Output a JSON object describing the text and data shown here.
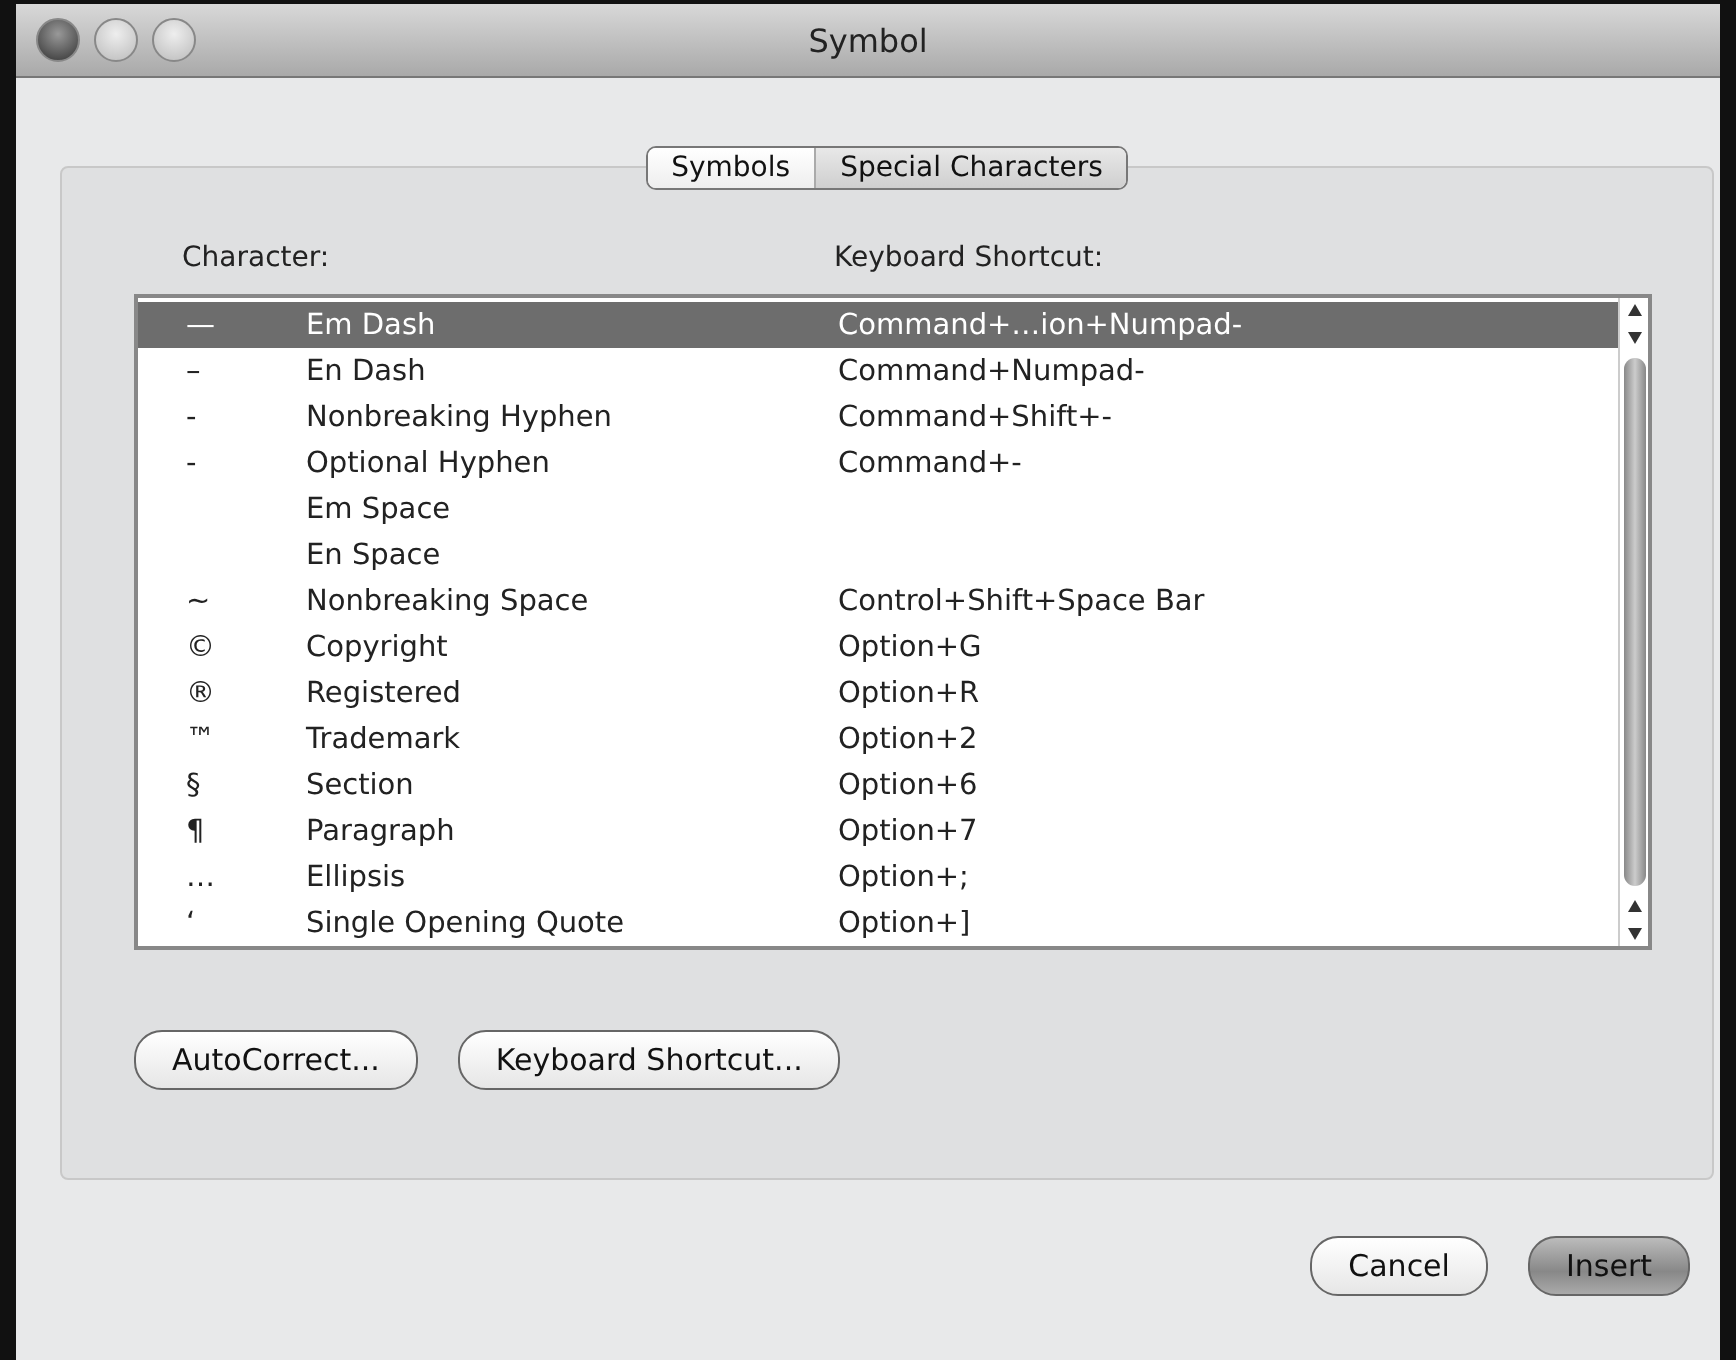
{
  "window": {
    "title": "Symbol"
  },
  "tabs": [
    {
      "label": "Symbols",
      "selected": false
    },
    {
      "label": "Special Characters",
      "selected": true
    }
  ],
  "columns": [
    "Character:",
    "Keyboard Shortcut:"
  ],
  "rows": [
    {
      "character": "—",
      "name": "Em Dash",
      "shortcut": "Command+…ion+Numpad-",
      "selected": true
    },
    {
      "character": "–",
      "name": "En Dash",
      "shortcut": "Command+Numpad-",
      "selected": false
    },
    {
      "character": "-",
      "name": "Nonbreaking Hyphen",
      "shortcut": "Command+Shift+-",
      "selected": false
    },
    {
      "character": "-",
      "name": "Optional Hyphen",
      "shortcut": "Command+-",
      "selected": false
    },
    {
      "name": "Em Space",
      "selected": false
    },
    {
      "name": "En Space",
      "selected": false
    },
    {
      "character": "~",
      "name": "Nonbreaking Space",
      "shortcut": "Control+Shift+Space Bar",
      "selected": false
    },
    {
      "character": "©",
      "name": "Copyright",
      "shortcut": "Option+G",
      "selected": false
    },
    {
      "character": "®",
      "name": "Registered",
      "shortcut": "Option+R",
      "selected": false
    },
    {
      "character": "™",
      "name": "Trademark",
      "shortcut": "Option+2",
      "selected": false
    },
    {
      "character": "§",
      "name": "Section",
      "shortcut": "Option+6",
      "selected": false
    },
    {
      "character": "¶",
      "name": "Paragraph",
      "shortcut": "Option+7",
      "selected": false
    },
    {
      "character": "…",
      "name": "Ellipsis",
      "shortcut": "Option+;",
      "selected": false
    },
    {
      "character": "‘",
      "name": "Single Opening Quote",
      "shortcut": "Option+]",
      "selected": false
    }
  ],
  "panel_buttons": [
    "AutoCorrect...",
    "Keyboard Shortcut..."
  ],
  "dialog_buttons": [
    {
      "label": "Cancel",
      "default": false
    },
    {
      "label": "Insert",
      "default": true
    }
  ]
}
